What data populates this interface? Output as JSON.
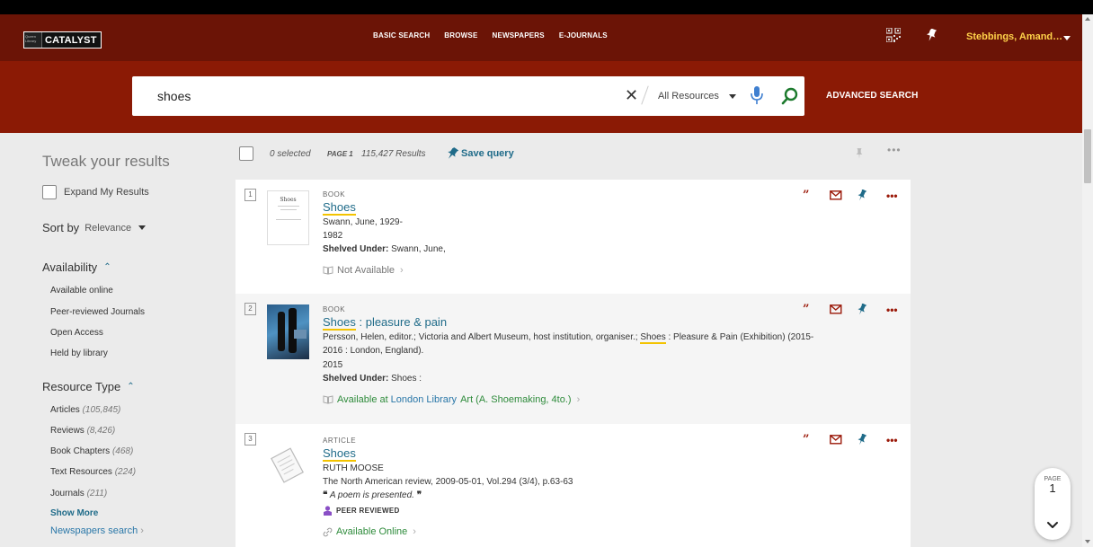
{
  "app": {
    "logo_text": "CATALYST",
    "logo_mark_text": "Queen Library"
  },
  "nav": {
    "links": [
      "BASIC SEARCH",
      "BROWSE",
      "NEWSPAPERS",
      "E-JOURNALS"
    ],
    "user": "Stebbings, Amand…"
  },
  "search": {
    "query": "shoes",
    "scope": "All Resources",
    "advanced_label": "ADVANCED SEARCH"
  },
  "sidebar": {
    "tweak_title": "Tweak your results",
    "expand_label": "Expand My Results",
    "sort_label": "Sort by",
    "sort_value": "Relevance",
    "availability_title": "Availability",
    "availability_items": [
      "Available online",
      "Peer-reviewed Journals",
      "Open Access",
      "Held by library"
    ],
    "resource_type_title": "Resource Type",
    "resource_types": [
      {
        "label": "Articles",
        "count": "(105,845)"
      },
      {
        "label": "Reviews",
        "count": "(8,426)"
      },
      {
        "label": "Book Chapters",
        "count": "(468)"
      },
      {
        "label": "Text Resources",
        "count": "(224)"
      },
      {
        "label": "Journals",
        "count": "(211)"
      }
    ],
    "show_more": "Show More",
    "newspapers_search": "Newspapers search"
  },
  "results_header": {
    "selected": "0 selected",
    "page": "PAGE 1",
    "count": "115,427 Results",
    "save_query": "Save query"
  },
  "results": [
    {
      "number": "1",
      "type": "BOOK",
      "title": "Shoes",
      "title_rest": "",
      "author": "Swann, June, 1929-",
      "year": "1982",
      "shelved_label": "Shelved Under:",
      "shelved_value": "Swann, June,",
      "availability": "Not Available",
      "thumb_title": "Shoes"
    },
    {
      "number": "2",
      "type": "BOOK",
      "title": "Shoes",
      "title_rest": " : pleasure & pain",
      "authors_line1_a": "Persson, Helen, editor.; Victoria and Albert Museum, host institution, organiser.; ",
      "authors_line1_hl": "Shoes",
      "authors_line1_b": " : Pleasure & Pain (Exhibition) (2015-",
      "authors_line2": "2016 : London, England).",
      "year": "2015",
      "shelved_label": "Shelved Under:",
      "shelved_value": "Shoes :",
      "availability_prefix": "Available at",
      "availability_location": "London Library",
      "availability_shelf": "Art (A. Shoemaking, 4to.)"
    },
    {
      "number": "3",
      "type": "ARTICLE",
      "title": "Shoes",
      "author": "RUTH MOOSE",
      "source": "The North American review, 2009-05-01, Vol.294 (3/4), p.63-63",
      "snippet": "A poem is presented.",
      "peer": "PEER REVIEWED",
      "availability": "Available Online"
    }
  ],
  "page_bubble": {
    "label": "PAGE",
    "number": "1"
  },
  "colors": {
    "topnav": "#6b1406",
    "searchband": "#8b1a05",
    "link": "#1f6b89",
    "highlight": "#f3c300",
    "action": "#9b1a0a",
    "user": "#ffd24a"
  },
  "icons": [
    "qr-code-icon",
    "pin-icon",
    "close-icon",
    "microphone-icon",
    "search-icon",
    "quote-icon",
    "email-icon",
    "more-icon",
    "book-icon",
    "link-icon",
    "chevron-down-icon"
  ]
}
